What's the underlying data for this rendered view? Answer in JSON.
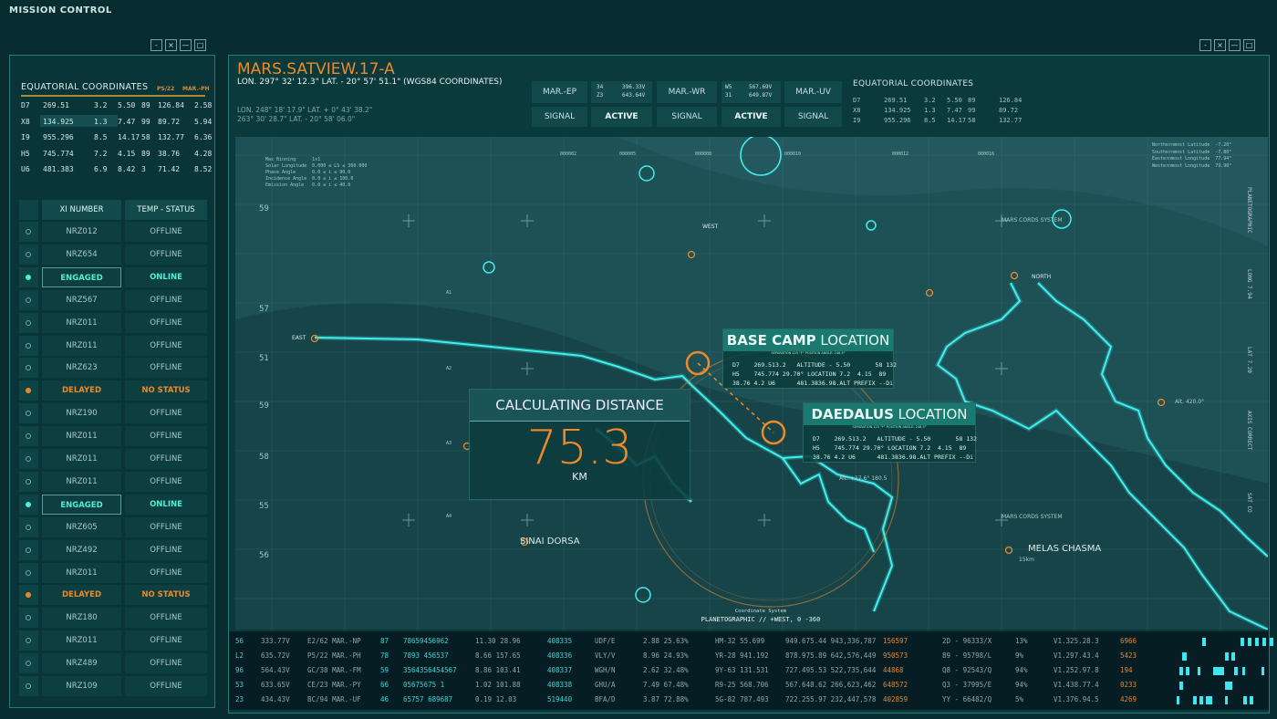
{
  "app_title": "MISSION CONTROL",
  "window_buttons": [
    "-",
    "×",
    "—",
    "□"
  ],
  "left": {
    "eq_title": "EQUATORIAL COORDINATES",
    "eq_tags": [
      "PS/22",
      "MAR.-PH"
    ],
    "eq_rows": [
      [
        "D7",
        "269.51",
        "3.2",
        "5.50",
        "89",
        "126.84",
        "2.58"
      ],
      [
        "X8",
        "134.925",
        "1.3",
        "7.47",
        "99",
        "89.72",
        "5.94"
      ],
      [
        "I9",
        "955.296",
        "8.5",
        "14.17",
        "58",
        "132.77",
        "6.36"
      ],
      [
        "H5",
        "745.774",
        "7.2",
        "4.15",
        "89",
        "38.76",
        "4.28"
      ],
      [
        "U6",
        "481.383",
        "6.9",
        "8.42",
        "3",
        "71.42",
        "8.52"
      ]
    ],
    "list_headers": [
      "XI NUMBER",
      "TEMP - STATUS"
    ],
    "list": [
      {
        "xi": "NRZ012",
        "status": "OFFLINE",
        "state": "off"
      },
      {
        "xi": "NRZ654",
        "status": "OFFLINE",
        "state": "off"
      },
      {
        "xi": "ENGAGED",
        "status": "ONLINE",
        "state": "eng"
      },
      {
        "xi": "NRZ567",
        "status": "OFFLINE",
        "state": "off"
      },
      {
        "xi": "NRZ011",
        "status": "OFFLINE",
        "state": "off"
      },
      {
        "xi": "NRZ011",
        "status": "OFFLINE",
        "state": "off"
      },
      {
        "xi": "NRZ623",
        "status": "OFFLINE",
        "state": "off"
      },
      {
        "xi": "DELAYED",
        "status": "NO STATUS",
        "state": "del"
      },
      {
        "xi": "NRZ190",
        "status": "OFFLINE",
        "state": "off"
      },
      {
        "xi": "NRZ011",
        "status": "OFFLINE",
        "state": "off"
      },
      {
        "xi": "NRZ011",
        "status": "OFFLINE",
        "state": "off"
      },
      {
        "xi": "NRZ011",
        "status": "OFFLINE",
        "state": "off"
      },
      {
        "xi": "ENGAGED",
        "status": "ONLINE",
        "state": "eng"
      },
      {
        "xi": "NRZ605",
        "status": "OFFLINE",
        "state": "off"
      },
      {
        "xi": "NRZ492",
        "status": "OFFLINE",
        "state": "off"
      },
      {
        "xi": "NRZ011",
        "status": "OFFLINE",
        "state": "off"
      },
      {
        "xi": "DELAYED",
        "status": "NO STATUS",
        "state": "del"
      },
      {
        "xi": "NRZ180",
        "status": "OFFLINE",
        "state": "off"
      },
      {
        "xi": "NRZ011",
        "status": "OFFLINE",
        "state": "off"
      },
      {
        "xi": "NRZ489",
        "status": "OFFLINE",
        "state": "off"
      },
      {
        "xi": "NRZ109",
        "status": "OFFLINE",
        "state": "off"
      }
    ]
  },
  "header": {
    "title": "MARS.SATVIEW.17-A",
    "coords": "LON. 297° 32' 12.3\"  LAT. -  20° 57' 51.1\" (WGS84 COORDINATES)",
    "coords2": "LON. 248° 18' 17.9\"  LAT. +  0° 43' 38.2\"",
    "coords3": "263° 30' 28.7\"  LAT. -  20° 58' 06.0\"",
    "buttons": [
      "MAR.-EP",
      "MAR.-WR",
      "MAR.-UV"
    ],
    "readouts": [
      {
        "a": "34",
        "b": "396.33V",
        "c": "Z3",
        "d": "643.64V"
      },
      {
        "a": "W5",
        "b": "567.69V",
        "c": "31",
        "d": "649.87V"
      }
    ],
    "signals": [
      "SIGNAL",
      "ACTIVE",
      "SIGNAL",
      "ACTIVE",
      "SIGNAL"
    ],
    "eq_title": "EQUATORIAL COORDINATES",
    "eq_rows": [
      [
        "D7",
        "269.51",
        "3.2",
        "5.50",
        "89",
        "126.84"
      ],
      [
        "X8",
        "134.925",
        "1.3",
        "7.47",
        "99",
        "89.72"
      ],
      [
        "I9",
        "955.296",
        "8.5",
        "14.17",
        "58",
        "132.77"
      ]
    ]
  },
  "map": {
    "params": [
      "Max Binning      1x1",
      "Solar Longitude  0.000 ≤ LS ≤ 360.000",
      "Phase Angle      0.0 ≤ i ≤ 90.0",
      "Incidence Angle  0.0 ≤ i ≤ 100.0",
      "Emission Angle   0.0 ≤ i ≤ 40.0"
    ],
    "extents": [
      "Northernmost Latitude  -7.20°",
      "Southernmost Latitude  -7.80°",
      "Easternmost Longitude  77.94°",
      "Westernmost Longitude  79.90°"
    ],
    "grid_top": [
      "000002",
      "000005",
      "000008",
      "000010",
      "000012",
      "000016"
    ],
    "grid_left": [
      "59",
      "57",
      "51",
      "59",
      "58",
      "55",
      "56"
    ],
    "grid_a": [
      "A1",
      "A2",
      "A3",
      "A4"
    ],
    "side_labels": [
      "PLANETOGRAPHIC",
      "LONG 7.94",
      "LAT 7.20",
      "AXIS CORRECT",
      "SAT CO"
    ],
    "places": {
      "west": "WEST",
      "east": "EAST",
      "north": "NORTH",
      "sinai": "SINAI DORSA",
      "melas": "MELAS CHASMA",
      "melas_sub": "15km",
      "alt1": "Alt. 420.0°",
      "alt2": "Alt. +17.6° 180.5",
      "cords1": "MARS CORDS SYSTEM",
      "cords2": "MARS CORDS SYSTEM"
    },
    "coord_system_label": "Coordinate System",
    "coord_system": "PLANETOGRAPHIC // +WEST, 0 -360",
    "distance": {
      "title": "CALCULATING DISTANCE",
      "value": "75.3",
      "unit": "KM"
    },
    "base_camp": {
      "bold": "BASE CAMP",
      "rest": " LOCATION",
      "sub": "SEPARATION 125 °F° POSITION ANGLE: 248.5°",
      "lines": [
        "D7    269.513.2   ALTITUDE - 5.50       58 132",
        "H5    745.774 29.70° LOCATION 7.2  4.15  89",
        "38.76 4.2 U6      481.3836.98.ALT PREFIX --Di"
      ]
    },
    "daedalus": {
      "bold": "DAEDALUS",
      "rest": " LOCATION",
      "sub": "SEPARATION 125 °F° POSITION ANGLE: 248.5°",
      "lines": [
        "D7    269.513.2   ALTITUDE - 5.50       58 132",
        "H5    745.774 29.70° LOCATION 7.2  4.15  89",
        "38.76 4.2 U6      481.3836.98.ALT PREFIX --Di"
      ]
    },
    "colors": {
      "coast": "#3ff0ee",
      "marker": "#ee8a2a"
    }
  },
  "bottom_rows": [
    [
      "56",
      "333.77V",
      "E2/62 MAR.-NP",
      "87",
      "78659456962",
      "11.30 28.96",
      "408335",
      "UDF/E",
      "2.88 25.63%",
      "HM-32 55.699",
      "949.675.44 943,336,787",
      "156597",
      "2D - 96333/X",
      "13%",
      "V1.325.28.3",
      "6966"
    ],
    [
      "L2",
      "635.72V",
      "P5/22 MAR.-PH",
      "78",
      "7893 456537",
      "8.66 157.65",
      "408336",
      "VLY/V",
      "8.96 24.93%",
      "YR-28 941.192",
      "878.975.89 642,576,449",
      "950573",
      "89 - 95798/L",
      "9%",
      "V1.297.43.4",
      "5423"
    ],
    [
      "96",
      "564.43V",
      "GC/38 MAR.-FM",
      "59",
      "3564356454567",
      "8.86 103.41",
      "408337",
      "WGH/N",
      "2.62 32.48%",
      "9Y-63 131.531",
      "727.495.53 522,735,644",
      "44868",
      "Q8 - 92543/Q",
      "94%",
      "V1.252.97.8",
      "194"
    ],
    [
      "53",
      "633.65V",
      "CE/23 MAR.-PY",
      "66",
      "05675675   1",
      "1.02 101.88",
      "408338",
      "GHU/A",
      "7.49 67.48%",
      "R9-25 568.706",
      "567.648.62 266,623,462",
      "648572",
      "Q3 - 37995/E",
      "94%",
      "V1.438.77.4",
      "0233"
    ],
    [
      "23",
      "434.43V",
      "BC/94 MAR.-UF",
      "46",
      "65757 689687",
      "0.19 12.03",
      "519440",
      "BFA/D",
      "3.87 72.88%",
      "5G-82 787.493",
      "722.255.97 232,447,578",
      "402859",
      "YY - 66482/Q",
      "5%",
      "V1.376.94.5",
      "4269"
    ]
  ]
}
